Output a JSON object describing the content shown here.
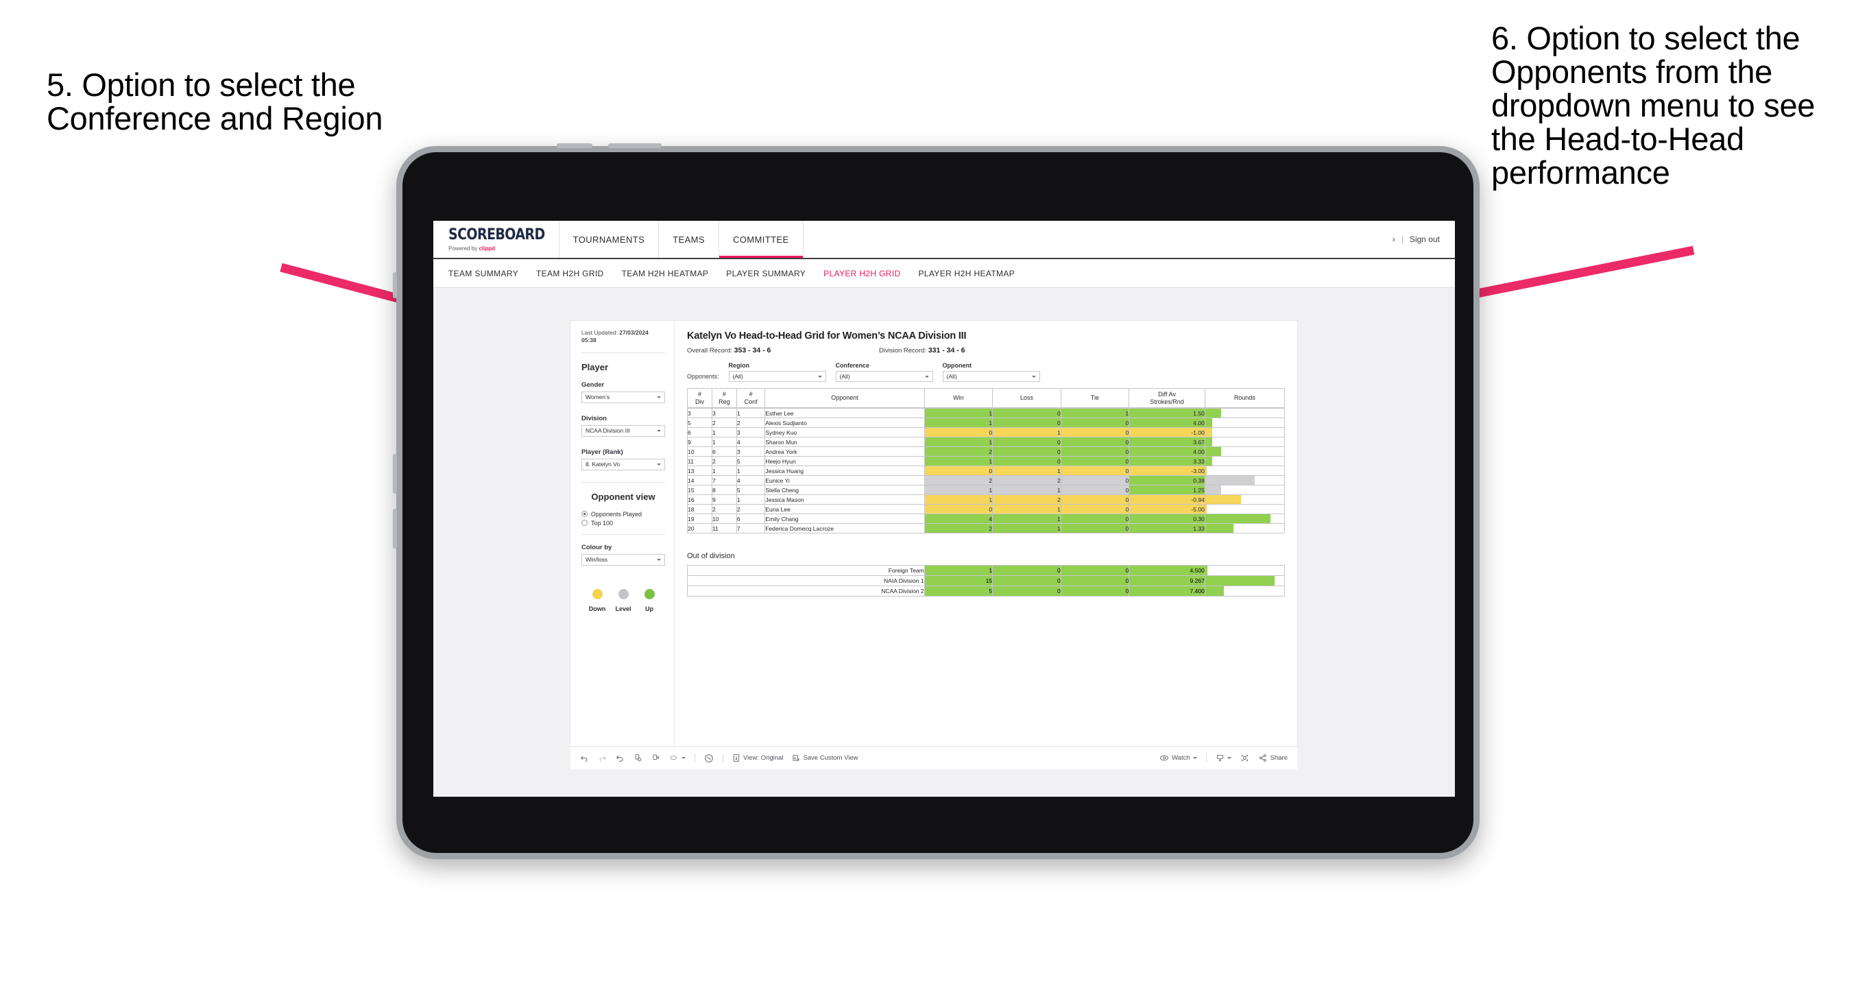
{
  "annotations": {
    "left": "5. Option to select the Conference and Region",
    "right": "6. Option to select the Opponents from the dropdown menu to see the Head-to-Head performance"
  },
  "header": {
    "brand_title": "SCOREBOARD",
    "brand_powered": "Powered by ",
    "brand_name": "clippd",
    "nav": [
      {
        "label": "TOURNAMENTS",
        "active": false
      },
      {
        "label": "TEAMS",
        "active": false
      },
      {
        "label": "COMMITTEE",
        "active": true
      }
    ],
    "chevron": "›",
    "divider": "|",
    "sign_out": "Sign out"
  },
  "subnav": [
    {
      "label": "TEAM SUMMARY",
      "active": false
    },
    {
      "label": "TEAM H2H GRID",
      "active": false
    },
    {
      "label": "TEAM H2H HEATMAP",
      "active": false
    },
    {
      "label": "PLAYER SUMMARY",
      "active": false
    },
    {
      "label": "PLAYER H2H GRID",
      "active": true
    },
    {
      "label": "PLAYER H2H HEATMAP",
      "active": false
    }
  ],
  "sidebar": {
    "last_updated_label": "Last Updated: ",
    "last_updated_value": "27/03/2024",
    "last_updated_time": "05:38",
    "player_section": "Player",
    "gender_label": "Gender",
    "gender_value": "Women’s",
    "division_label": "Division",
    "division_value": "NCAA Division III",
    "player_rank_label": "Player (Rank)",
    "player_rank_value": "8. Katelyn Vo",
    "opponent_view_title": "Opponent view",
    "opponent_view_options": [
      {
        "label": "Opponents Played",
        "selected": true
      },
      {
        "label": "Top 100",
        "selected": false
      }
    ],
    "colour_by_label": "Colour by",
    "colour_by_value": "Win/loss",
    "legend": [
      {
        "label": "Down",
        "color": "#f5d34f"
      },
      {
        "label": "Level",
        "color": "#c3c3c8"
      },
      {
        "label": "Up",
        "color": "#7ac143"
      }
    ]
  },
  "viz": {
    "title": "Katelyn Vo Head-to-Head Grid for Women’s NCAA Division III",
    "overall_record_label": "Overall Record: ",
    "overall_record_value": "353 - 34 - 6",
    "division_record_label": "Division Record: ",
    "division_record_value": "331 - 34 - 6",
    "opponents_label": "Opponents:",
    "filters": [
      {
        "label": "Region",
        "value": "(All)"
      },
      {
        "label": "Conference",
        "value": "(All)"
      },
      {
        "label": "Opponent",
        "value": "(All)"
      }
    ]
  },
  "chart_data": {
    "type": "table",
    "title": "Katelyn Vo Head-to-Head Grid for Women’s NCAA Division III",
    "columns": [
      "# Div",
      "# Reg",
      "# Conf",
      "Opponent",
      "Win",
      "Loss",
      "Tie",
      "Diff Av Strokes/Rnd",
      "Rounds"
    ],
    "column_headers_multiline": [
      {
        "l1": "#",
        "l2": "Div"
      },
      {
        "l1": "#",
        "l2": "Reg"
      },
      {
        "l1": "#",
        "l2": "Conf"
      },
      {
        "l1": "Opponent",
        "l2": ""
      },
      {
        "l1": "Win",
        "l2": ""
      },
      {
        "l1": "Loss",
        "l2": ""
      },
      {
        "l1": "Tie",
        "l2": ""
      },
      {
        "l1": "Diff Av",
        "l2": "Strokes/Rnd"
      },
      {
        "l1": "Rounds",
        "l2": ""
      }
    ],
    "rounds_max": 12,
    "rows": [
      {
        "div": "3",
        "reg": "3",
        "conf": "1",
        "opponent": "Esther Lee",
        "win": "1",
        "loss": "0",
        "tie": "1",
        "diff": "1.50",
        "rounds": "4",
        "rounds_pct": 20,
        "state": "up"
      },
      {
        "div": "5",
        "reg": "2",
        "conf": "2",
        "opponent": "Alexis Sudjianto",
        "win": "1",
        "loss": "0",
        "tie": "0",
        "diff": "4.00",
        "rounds": "3",
        "rounds_pct": 9,
        "state": "up"
      },
      {
        "div": "6",
        "reg": "1",
        "conf": "3",
        "opponent": "Sydney Kuo",
        "win": "0",
        "loss": "1",
        "tie": "0",
        "diff": "-1.00",
        "rounds": "3",
        "rounds_pct": 9,
        "state": "down"
      },
      {
        "div": "9",
        "reg": "1",
        "conf": "4",
        "opponent": "Sharon Mun",
        "win": "1",
        "loss": "0",
        "tie": "0",
        "diff": "3.67",
        "rounds": "3",
        "rounds_pct": 9,
        "state": "up"
      },
      {
        "div": "10",
        "reg": "6",
        "conf": "3",
        "opponent": "Andrea York",
        "win": "2",
        "loss": "0",
        "tie": "0",
        "diff": "4.00",
        "rounds": "4",
        "rounds_pct": 20,
        "state": "up"
      },
      {
        "div": "11",
        "reg": "2",
        "conf": "5",
        "opponent": "Heejo Hyun",
        "win": "1",
        "loss": "0",
        "tie": "0",
        "diff": "3.33",
        "rounds": "3",
        "rounds_pct": 9,
        "state": "up"
      },
      {
        "div": "13",
        "reg": "1",
        "conf": "1",
        "opponent": "Jessica Huang",
        "win": "0",
        "loss": "1",
        "tie": "0",
        "diff": "-3.00",
        "rounds": "2",
        "rounds_pct": 2,
        "state": "down"
      },
      {
        "div": "14",
        "reg": "7",
        "conf": "4",
        "opponent": "Eunice Yi",
        "win": "2",
        "loss": "2",
        "tie": "0",
        "diff": "0.38",
        "rounds": "9",
        "rounds_pct": 63,
        "state": "level",
        "diff_state": "up"
      },
      {
        "div": "15",
        "reg": "8",
        "conf": "5",
        "opponent": "Stella Cheng",
        "win": "1",
        "loss": "1",
        "tie": "0",
        "diff": "1.25",
        "rounds": "4",
        "rounds_pct": 20,
        "state": "level",
        "diff_state": "up"
      },
      {
        "div": "16",
        "reg": "9",
        "conf": "1",
        "opponent": "Jessica Mason",
        "win": "1",
        "loss": "2",
        "tie": "0",
        "diff": "-0.94",
        "rounds": "7",
        "rounds_pct": 45,
        "state": "down"
      },
      {
        "div": "18",
        "reg": "2",
        "conf": "2",
        "opponent": "Euna Lee",
        "win": "0",
        "loss": "1",
        "tie": "0",
        "diff": "-5.00",
        "rounds": "2",
        "rounds_pct": 2,
        "state": "down"
      },
      {
        "div": "19",
        "reg": "10",
        "conf": "6",
        "opponent": "Emily Chang",
        "win": "4",
        "loss": "1",
        "tie": "0",
        "diff": "0.30",
        "rounds": "11",
        "rounds_pct": 83,
        "state": "up"
      },
      {
        "div": "20",
        "reg": "11",
        "conf": "7",
        "opponent": "Federica Domecq Lacroze",
        "win": "2",
        "loss": "1",
        "tie": "0",
        "diff": "1.33",
        "rounds": "6",
        "rounds_pct": 36,
        "state": "up"
      }
    ],
    "out_of_division_title": "Out of division",
    "out_of_division": [
      {
        "name": "Foreign Team",
        "win": "1",
        "loss": "0",
        "tie": "0",
        "diff": "4.500",
        "rounds": "2",
        "rounds_pct": 3,
        "state": "up"
      },
      {
        "name": "NAIA Division 1",
        "win": "15",
        "loss": "0",
        "tie": "0",
        "diff": "9.267",
        "rounds": "30",
        "rounds_pct": 88,
        "state": "up"
      },
      {
        "name": "NCAA Division 2",
        "win": "5",
        "loss": "0",
        "tie": "0",
        "diff": "7.400",
        "rounds": "10",
        "rounds_pct": 24,
        "state": "up"
      }
    ]
  },
  "toolbar": {
    "view_label": "View: Original",
    "save_label": "Save Custom View",
    "watch_label": "Watch",
    "share_label": "Share"
  },
  "colors": {
    "accent": "#e8185d",
    "up": "#92d050",
    "down": "#f5d65a",
    "level": "#d0d0d3"
  }
}
